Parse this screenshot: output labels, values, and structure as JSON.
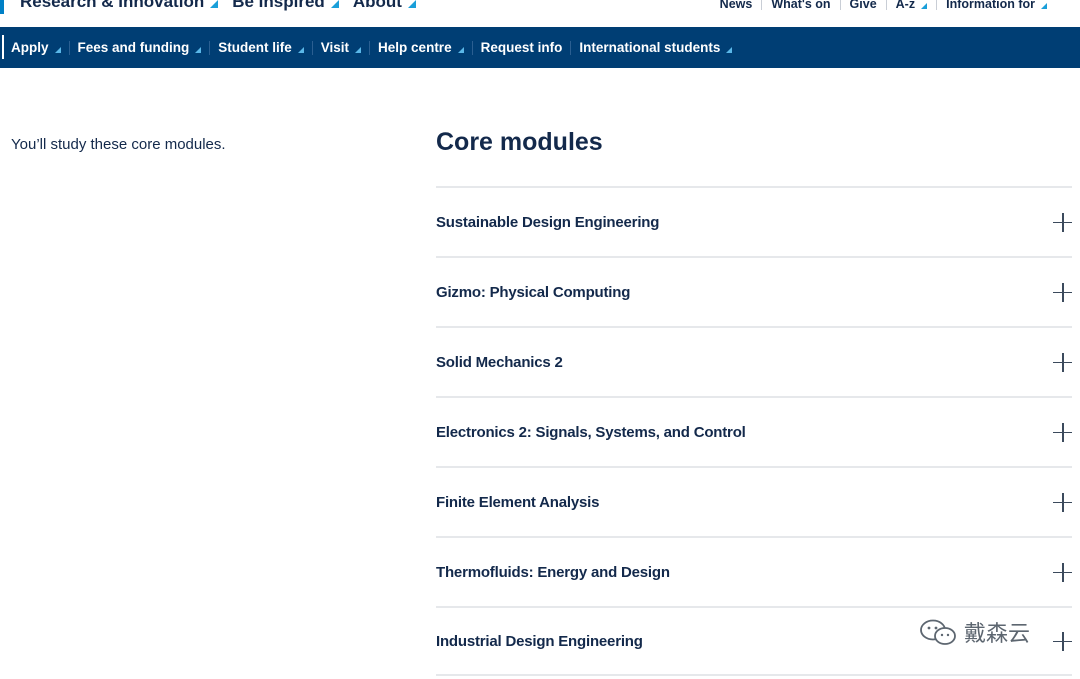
{
  "primary_nav": [
    {
      "label": "Research & Innovation"
    },
    {
      "label": "Be Inspired"
    },
    {
      "label": "About"
    }
  ],
  "utility_nav": [
    {
      "label": "News",
      "dropdown": false
    },
    {
      "label": "What's on",
      "dropdown": false
    },
    {
      "label": "Give",
      "dropdown": false
    },
    {
      "label": "A-z",
      "dropdown": true
    },
    {
      "label": "Information for",
      "dropdown": true
    }
  ],
  "secondary_nav": [
    {
      "label": "Apply",
      "dropdown": true
    },
    {
      "label": "Fees and funding",
      "dropdown": true
    },
    {
      "label": "Student life",
      "dropdown": true
    },
    {
      "label": "Visit",
      "dropdown": true
    },
    {
      "label": "Help centre",
      "dropdown": true
    },
    {
      "label": "Request info",
      "dropdown": false
    },
    {
      "label": "International students",
      "dropdown": true
    }
  ],
  "content": {
    "intro": "You’ll study these core modules.",
    "section_title": "Core modules",
    "modules": [
      "Sustainable Design Engineering",
      "Gizmo: Physical Computing",
      "Solid Mechanics 2",
      "Electronics 2: Signals, Systems, and Control",
      "Finite Element Analysis",
      "Thermofluids: Energy and Design",
      "Industrial Design Engineering"
    ]
  },
  "watermark": {
    "text": "戴森云"
  },
  "colors": {
    "navy": "#003e74",
    "text_dark": "#13294b",
    "accent_triangle": "#1a9fd9",
    "divider": "#e6e8eb"
  }
}
